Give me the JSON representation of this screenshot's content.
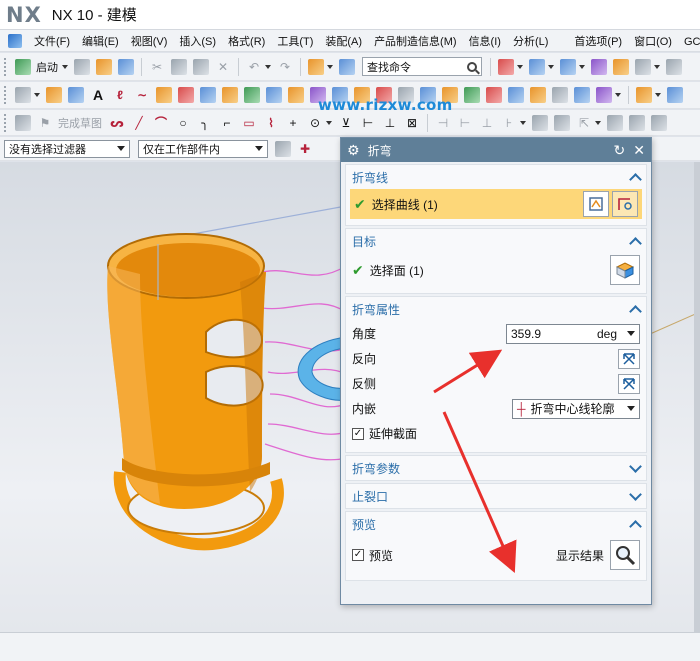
{
  "window": {
    "logo": "NX",
    "title": "NX 10 - 建模"
  },
  "menu": [
    "文件(F)",
    "编辑(E)",
    "视图(V)",
    "插入(S)",
    "格式(R)",
    "工具(T)",
    "装配(A)",
    "产品制造信息(M)",
    "信息(I)",
    "分析(L)",
    "首选项(P)",
    "窗口(O)",
    "GC工具箱"
  ],
  "toolbar": {
    "start_label": "启动",
    "search_placeholder": "查找命令",
    "sketch_label": "完成草图"
  },
  "filters": {
    "selection_filter": "没有选择过滤器",
    "scope": "仅在工作部件内"
  },
  "watermark": "www.rjzxw.com",
  "dialog": {
    "title": "折弯",
    "bend_line": {
      "header": "折弯线",
      "select_label": "选择曲线 (1)"
    },
    "target": {
      "header": "目标",
      "select_label": "选择面 (1)"
    },
    "properties": {
      "header": "折弯属性",
      "angle_label": "角度",
      "angle_value": "359.9",
      "angle_unit": "deg",
      "reverse_label": "反向",
      "reverse_side_label": "反侧",
      "inlay_label": "内嵌",
      "inlay_value": "折弯中心线轮廓",
      "extend_label": "延伸截面",
      "extend_checked": "✓"
    },
    "bend_params": {
      "header": "折弯参数"
    },
    "relief": {
      "header": "止裂口"
    },
    "preview": {
      "header": "预览",
      "preview_label": "预览",
      "preview_checked": "✓",
      "show_result_label": "显示结果"
    }
  },
  "colors": {
    "accent_blue": "#2b6ea9",
    "highlight_yellow": "#fdd779",
    "part_orange": "#f29a0e",
    "dialog_title": "#5f7f98",
    "annotation_red": "#e8302c"
  }
}
